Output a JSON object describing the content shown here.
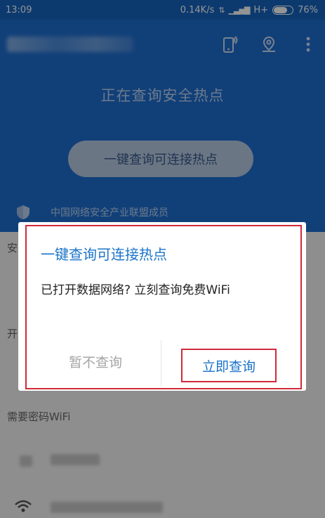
{
  "status_bar": {
    "time": "13:09",
    "net_speed": "0.14K/s",
    "network_type": "H+",
    "battery_percent": "76%",
    "battery_level": 0.76
  },
  "header": {
    "status_text": "正在查询安全热点",
    "query_button_label": "一键查询可连接热点",
    "member_label": "中国网络安全产业联盟成员",
    "icons": [
      "phone-signal-icon",
      "location-pin-icon",
      "more-vert-icon"
    ]
  },
  "background_list": {
    "section_partial_1": "安",
    "section_partial_2": "开",
    "section_password_wifi": "需要密码WiFi"
  },
  "dialog": {
    "title": "一键查询可连接热点",
    "message": "已打开数据网络? 立刻查询免费WiFi",
    "cancel_label": "暂不查询",
    "confirm_label": "立即查询"
  },
  "colors": {
    "header_blue": "#1e6ed1",
    "accent_blue": "#1a73c9",
    "highlight_red": "#d02a3a"
  }
}
